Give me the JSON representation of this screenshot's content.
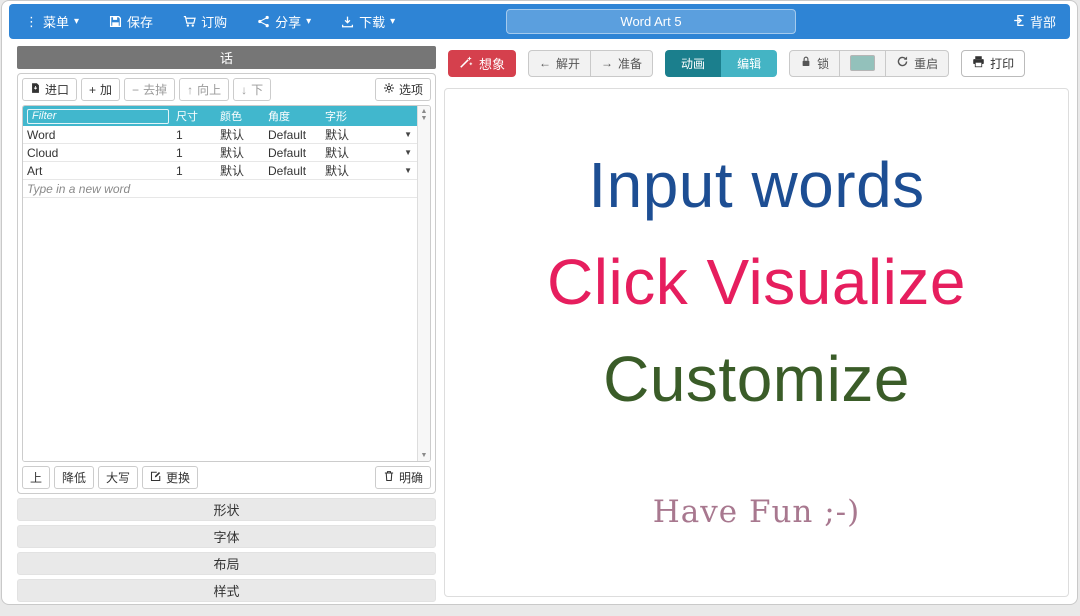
{
  "topbar": {
    "menu_label": "菜单",
    "save_label": "保存",
    "order_label": "订购",
    "share_label": "分享",
    "download_label": "下载",
    "title_value": "Word Art 5",
    "back_label": "背部"
  },
  "icons": {
    "menu_dots": "⋮",
    "caret_down": "▾",
    "dropdown_caret": "▼",
    "plus": "+",
    "minus": "−",
    "arrow_up": "↑",
    "arrow_down": "↓",
    "undo_arrow": "←",
    "redo_arrow": "→",
    "scroll_up": "▲",
    "scroll_down": "▼"
  },
  "colors": {
    "topbar_blue": "#2e84d5",
    "panel_header_gray": "#767676",
    "table_header_teal": "#41b7cd",
    "visualize_red": "#d5404d",
    "animate_teal": "#1b7f8d",
    "edit_teal": "#44b4c4"
  },
  "words_panel": {
    "header_title": "话",
    "toolbar": {
      "import_label": "进口",
      "add_label": "加",
      "remove_label": "去掉",
      "up_label": "向上",
      "down_label": "下",
      "options_label": "选项"
    },
    "table": {
      "filter_placeholder": "Filter",
      "columns": {
        "size": "尺寸",
        "color": "颜色",
        "angle": "角度",
        "font": "字形"
      },
      "rows": [
        {
          "word": "Word",
          "size": "1",
          "color": "默认",
          "angle": "Default",
          "font": "默认"
        },
        {
          "word": "Cloud",
          "size": "1",
          "color": "默认",
          "angle": "Default",
          "font": "默认"
        },
        {
          "word": "Art",
          "size": "1",
          "color": "默认",
          "angle": "Default",
          "font": "默认"
        }
      ],
      "new_word_placeholder": "Type in a new word"
    },
    "bottom_toolbar": {
      "up_label": "上",
      "lower_label": "降低",
      "uppercase_label": "大写",
      "replace_label": "更换",
      "clear_label": "明确"
    }
  },
  "sections": [
    "形状",
    "字体",
    "布局",
    "样式"
  ],
  "canvas_toolbar": {
    "visualize_label": "想象",
    "undo_label": "解开",
    "redo_label": "准备",
    "animate_label": "动画",
    "edit_label": "编辑",
    "lock_label": "锁",
    "restart_label": "重启",
    "print_label": "打印",
    "swatch_color": "#93c1bb"
  },
  "canvas": {
    "lines": [
      {
        "text": "Input words",
        "color": "#1d4e93"
      },
      {
        "text": "Click Visualize",
        "color": "#e61e5e"
      },
      {
        "text": "Customize",
        "color": "#3a5c28"
      }
    ],
    "footer": {
      "text": "Have Fun ;-)",
      "color": "#a8788f"
    }
  }
}
